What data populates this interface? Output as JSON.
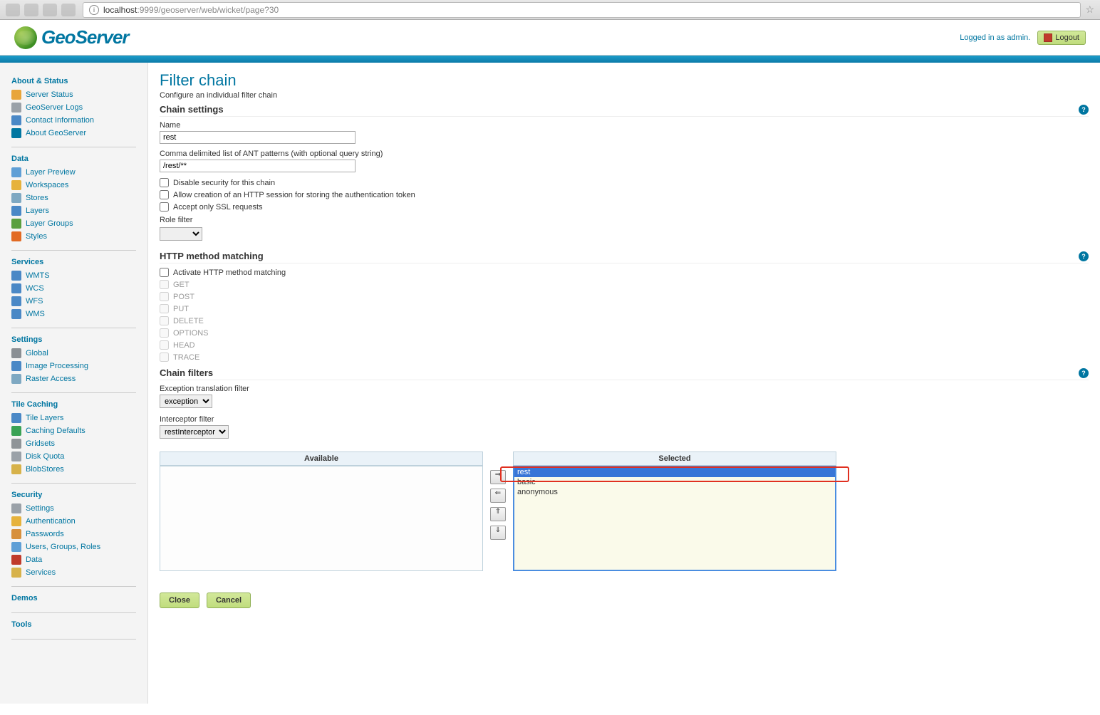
{
  "browser": {
    "url_host": "localhost",
    "url_port": ":9999",
    "url_path": "/geoserver/web/wicket/page?30"
  },
  "header": {
    "logo_text": "GeoServer",
    "login_text": "Logged in as admin.",
    "logout": "Logout"
  },
  "sidebar": {
    "about": {
      "header": "About & Status",
      "items": [
        "Server Status",
        "GeoServer Logs",
        "Contact Information",
        "About GeoServer"
      ]
    },
    "data": {
      "header": "Data",
      "items": [
        "Layer Preview",
        "Workspaces",
        "Stores",
        "Layers",
        "Layer Groups",
        "Styles"
      ]
    },
    "services": {
      "header": "Services",
      "items": [
        "WMTS",
        "WCS",
        "WFS",
        "WMS"
      ]
    },
    "settings": {
      "header": "Settings",
      "items": [
        "Global",
        "Image Processing",
        "Raster Access"
      ]
    },
    "tile": {
      "header": "Tile Caching",
      "items": [
        "Tile Layers",
        "Caching Defaults",
        "Gridsets",
        "Disk Quota",
        "BlobStores"
      ]
    },
    "security": {
      "header": "Security",
      "items": [
        "Settings",
        "Authentication",
        "Passwords",
        "Users, Groups, Roles",
        "Data",
        "Services"
      ]
    },
    "demos": {
      "header": "Demos"
    },
    "tools": {
      "header": "Tools"
    }
  },
  "page": {
    "title": "Filter chain",
    "description": "Configure an individual filter chain",
    "chain_settings_title": "Chain settings",
    "name_label": "Name",
    "name_value": "rest",
    "patterns_label": "Comma delimited list of ANT patterns (with optional query string)",
    "patterns_value": "/rest/**",
    "disable_security": "Disable security for this chain",
    "allow_session": "Allow creation of an HTTP session for storing the authentication token",
    "accept_ssl": "Accept only SSL requests",
    "role_filter_label": "Role filter",
    "http_title": "HTTP method matching",
    "activate_http": "Activate HTTP method matching",
    "methods": [
      "GET",
      "POST",
      "PUT",
      "DELETE",
      "OPTIONS",
      "HEAD",
      "TRACE"
    ],
    "chain_filters_title": "Chain filters",
    "exception_label": "Exception translation filter",
    "exception_value": "exception",
    "interceptor_label": "Interceptor filter",
    "interceptor_value": "restInterceptor",
    "palette_available": "Available",
    "palette_selected": "Selected",
    "selected_items": [
      "rest",
      "basic",
      "anonymous"
    ],
    "close": "Close",
    "cancel": "Cancel"
  },
  "icon_colors": {
    "about": [
      "#e8a53a",
      "#9aa1a8",
      "#4a88c6",
      "#0076a1"
    ],
    "data": [
      "#5f9fd6",
      "#e6b23c",
      "#7ea8c2",
      "#4a88c6",
      "#5a9f3f",
      "#e26a23"
    ],
    "services": [
      "#4a88c6",
      "#4a88c6",
      "#4a88c6",
      "#4a88c6"
    ],
    "settings": [
      "#8a8f94",
      "#4a88c6",
      "#7ea8c2"
    ],
    "tile": [
      "#4a88c6",
      "#3aa255",
      "#8f9498",
      "#9aa1a8",
      "#d7b24a"
    ],
    "security": [
      "#9aa1a8",
      "#e6b23c",
      "#d7903c",
      "#5f9fd6",
      "#c03a2b",
      "#d7b24a"
    ]
  }
}
